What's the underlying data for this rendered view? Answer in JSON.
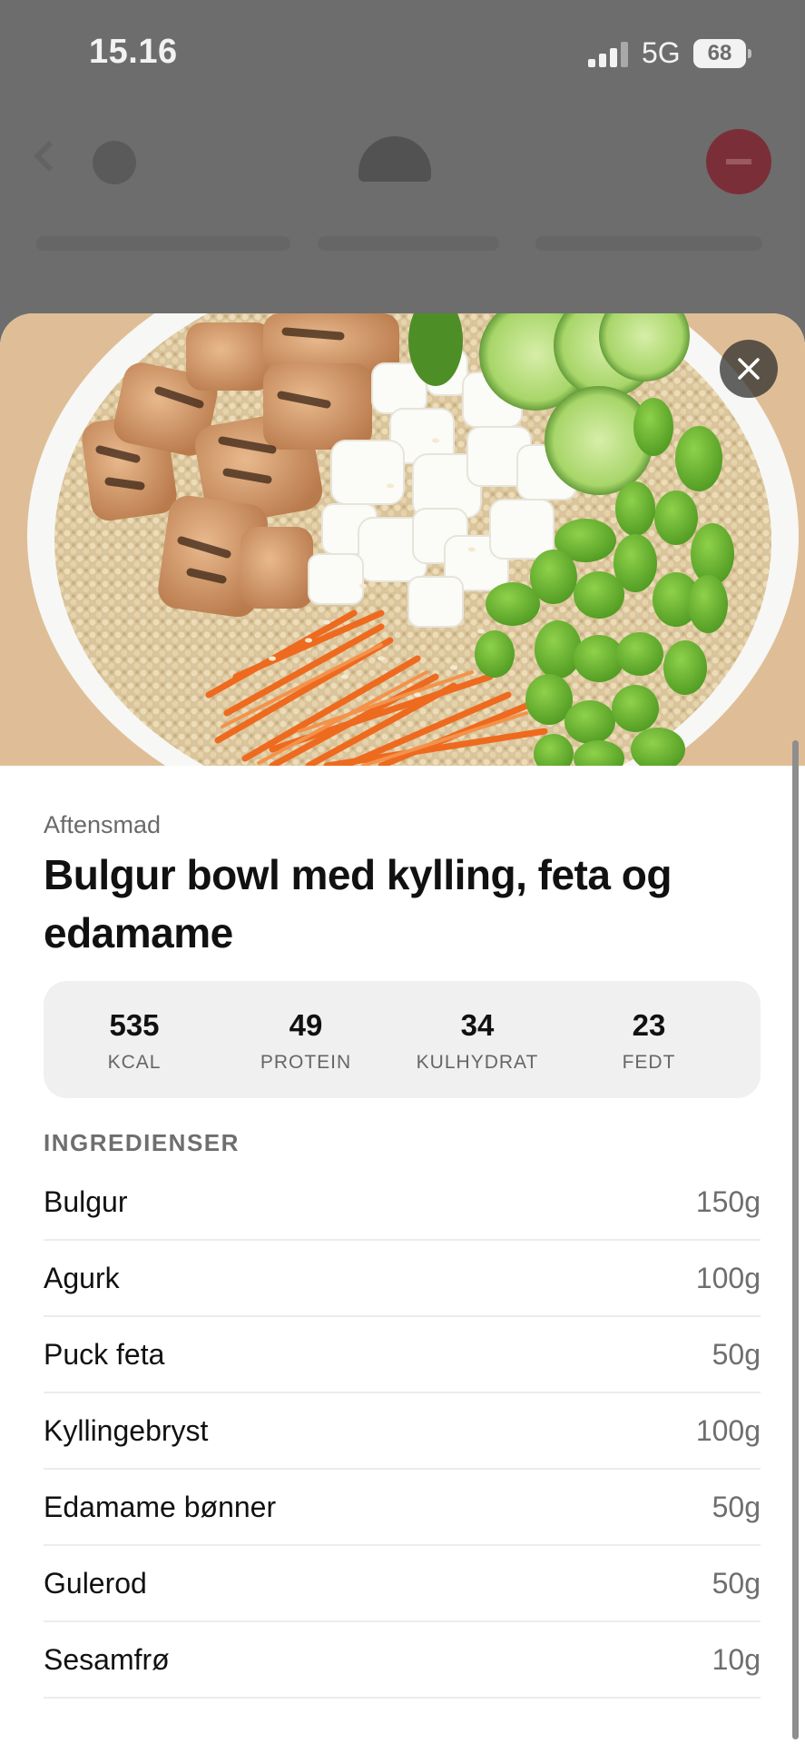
{
  "status_bar": {
    "time": "15.16",
    "network": "5G",
    "battery": "68"
  },
  "recipe": {
    "category": "Aftensmad",
    "title": "Bulgur bowl med kylling, feta og edamame",
    "image_icon": "food-bowl-photo",
    "close_icon": "close-icon"
  },
  "macros": [
    {
      "value": "535",
      "label": "KCAL"
    },
    {
      "value": "49",
      "label": "PROTEIN"
    },
    {
      "value": "34",
      "label": "KULHYDRAT"
    },
    {
      "value": "23",
      "label": "FEDT"
    }
  ],
  "ingredients": {
    "heading": "INGREDIENSER",
    "items": [
      {
        "name": "Bulgur",
        "amount": "150g"
      },
      {
        "name": "Agurk",
        "amount": "100g"
      },
      {
        "name": "Puck feta",
        "amount": "50g"
      },
      {
        "name": "Kyllingebryst",
        "amount": "100g"
      },
      {
        "name": "Edamame bønner",
        "amount": "50g"
      },
      {
        "name": "Gulerod",
        "amount": "50g"
      },
      {
        "name": "Sesamfrø",
        "amount": "10g"
      }
    ]
  }
}
